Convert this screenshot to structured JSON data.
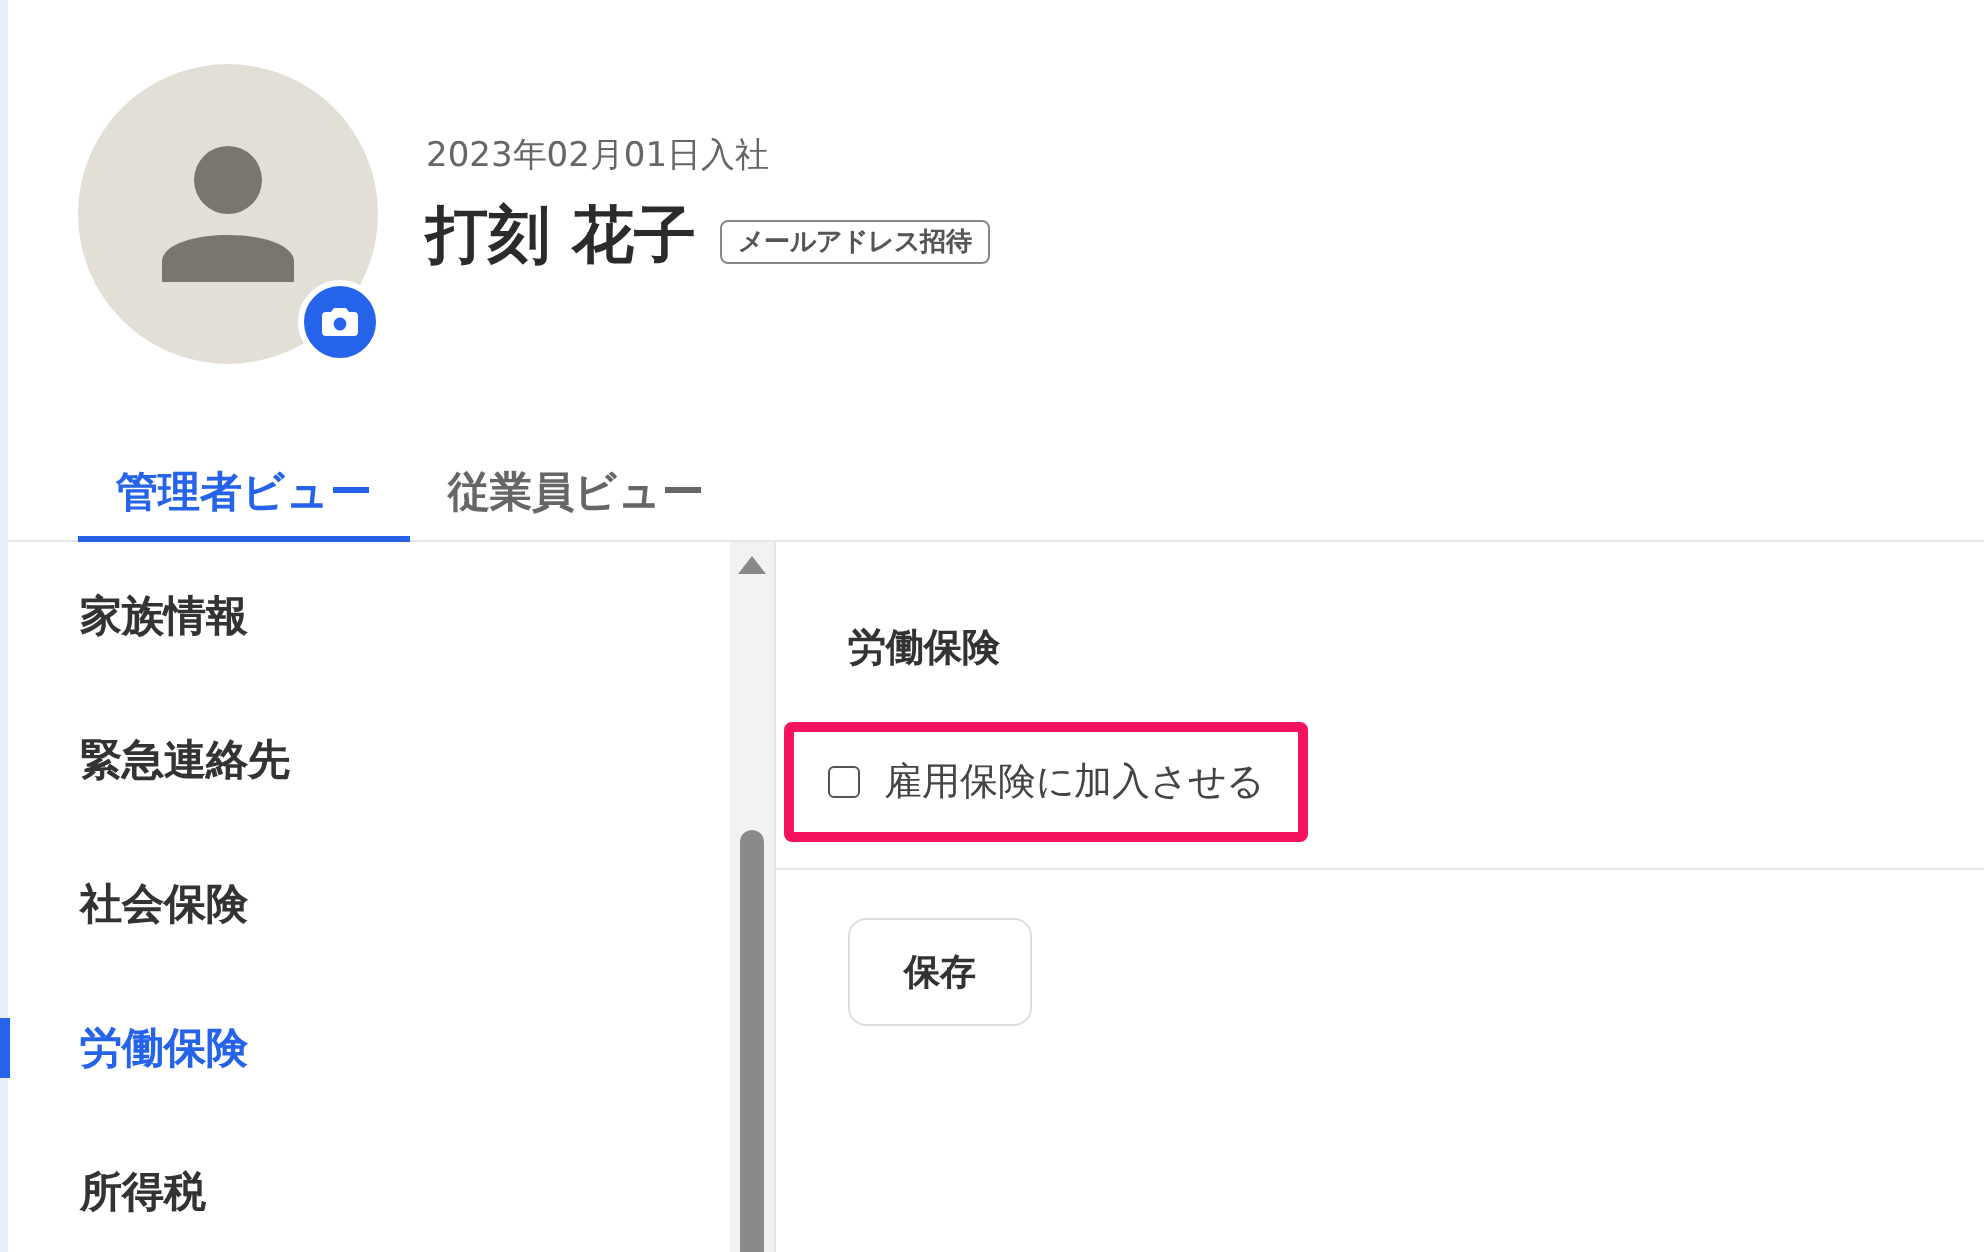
{
  "profile": {
    "joined": "2023年02月01日入社",
    "name": "打刻 花子",
    "badge": "メールアドレス招待"
  },
  "tabs": [
    {
      "label": "管理者ビュー",
      "selected": true
    },
    {
      "label": "従業員ビュー",
      "selected": false
    }
  ],
  "sidebar": {
    "items": [
      {
        "label": "家族情報",
        "selected": false
      },
      {
        "label": "緊急連絡先",
        "selected": false
      },
      {
        "label": "社会保険",
        "selected": false
      },
      {
        "label": "労働保険",
        "selected": true
      },
      {
        "label": "所得税",
        "selected": false
      }
    ]
  },
  "section": {
    "title": "労働保険",
    "checkbox": {
      "label": "雇用保険に加入させる",
      "checked": false,
      "highlighted": true
    },
    "save_button": "保存"
  }
}
